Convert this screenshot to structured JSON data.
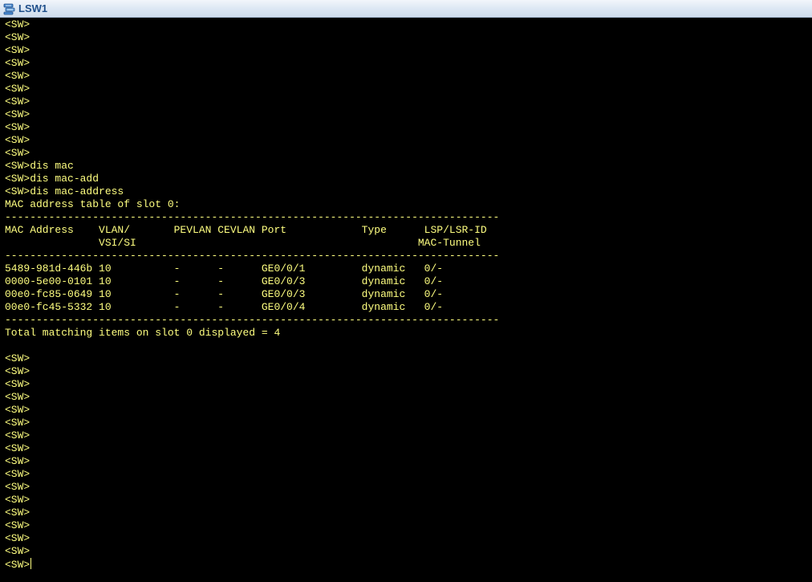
{
  "window": {
    "title": "LSW1",
    "icon": "network-switch-icon",
    "accent_color": "#1f4f8a",
    "terminal_bg": "#000000",
    "terminal_fg": "#ffff80"
  },
  "terminal": {
    "lines": [
      "<SW>",
      "<SW>",
      "<SW>",
      "<SW>",
      "<SW>",
      "<SW>",
      "<SW>",
      "<SW>",
      "<SW>",
      "<SW>",
      "<SW>",
      "<SW>dis mac",
      "<SW>dis mac-add",
      "<SW>dis mac-address",
      "MAC address table of slot 0:",
      "-------------------------------------------------------------------------------",
      "MAC Address    VLAN/       PEVLAN CEVLAN Port            Type      LSP/LSR-ID",
      "               VSI/SI                                             MAC-Tunnel",
      "-------------------------------------------------------------------------------",
      "5489-981d-446b 10          -      -      GE0/0/1         dynamic   0/-",
      "0000-5e00-0101 10          -      -      GE0/0/3         dynamic   0/-",
      "00e0-fc85-0649 10          -      -      GE0/0/3         dynamic   0/-",
      "00e0-fc45-5332 10          -      -      GE0/0/4         dynamic   0/-",
      "-------------------------------------------------------------------------------",
      "Total matching items on slot 0 displayed = 4",
      "",
      "<SW>",
      "<SW>",
      "<SW>",
      "<SW>",
      "<SW>",
      "<SW>",
      "<SW>",
      "<SW>",
      "<SW>",
      "<SW>",
      "<SW>",
      "<SW>",
      "<SW>",
      "<SW>",
      "<SW>",
      "<SW>"
    ],
    "prompt": "<SW>"
  }
}
